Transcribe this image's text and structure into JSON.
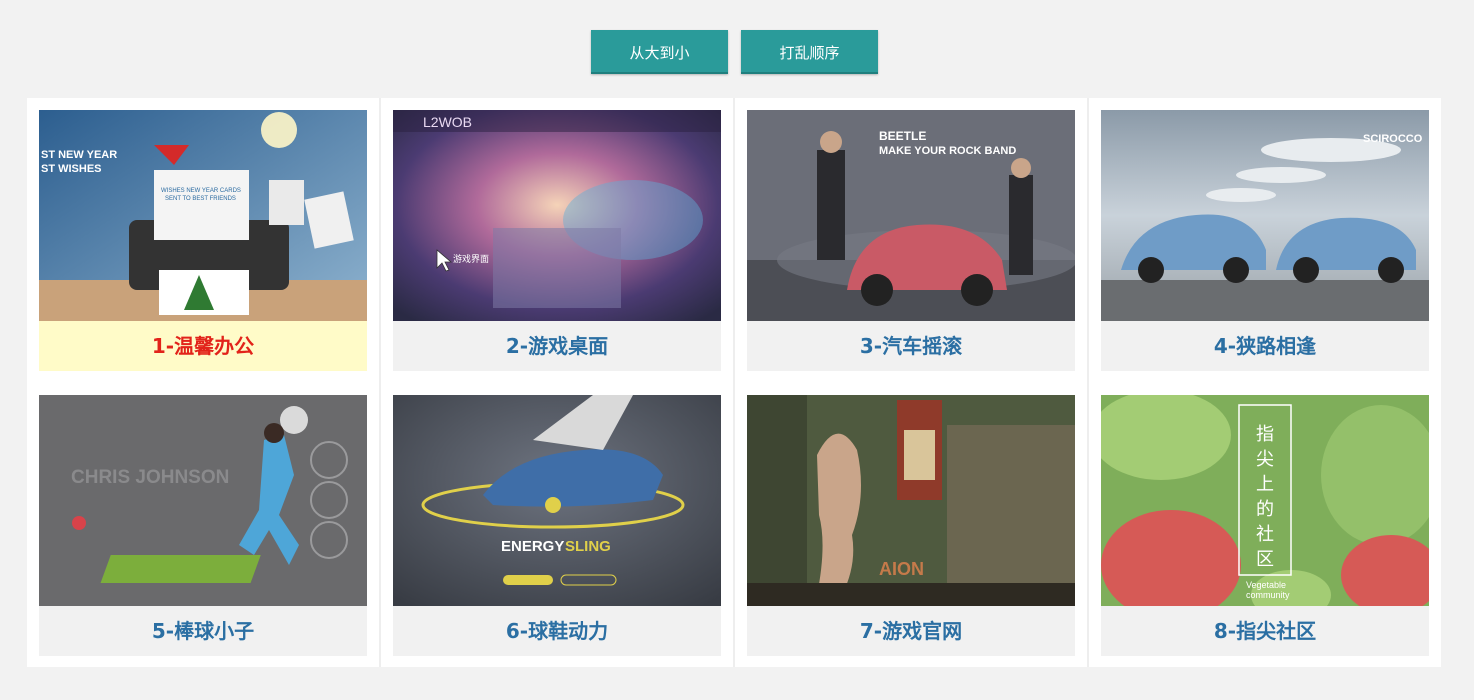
{
  "toolbar": {
    "sort_label": "从大到小",
    "shuffle_label": "打乱顺序"
  },
  "cards": [
    {
      "caption": "1-温馨办公",
      "active": true,
      "texts": [
        "ST NEW YEAR",
        "ST WISHES",
        "WISHES NEW YEAR CARDS",
        "SENT TO BEST FRIENDS"
      ]
    },
    {
      "caption": "2-游戏桌面",
      "active": false,
      "texts": [
        "L2WOB",
        "游戏界面"
      ]
    },
    {
      "caption": "3-汽车摇滚",
      "active": false,
      "texts": [
        "BEETLE",
        "MAKE YOUR ROCK BAND"
      ]
    },
    {
      "caption": "4-狭路相逢",
      "active": false,
      "texts": [
        "SCIROCCO"
      ]
    },
    {
      "caption": "5-棒球小子",
      "active": false,
      "texts": [
        "CHRIS JOHNSON"
      ]
    },
    {
      "caption": "6-球鞋动力",
      "active": false,
      "texts": [
        "ENERGY",
        "SLING"
      ]
    },
    {
      "caption": "7-游戏官网",
      "active": false,
      "texts": [
        "AION"
      ]
    },
    {
      "caption": "8-指尖社区",
      "active": false,
      "texts": [
        "指",
        "尖",
        "上",
        "的",
        "社",
        "区",
        "Vegetable",
        "community"
      ]
    }
  ]
}
